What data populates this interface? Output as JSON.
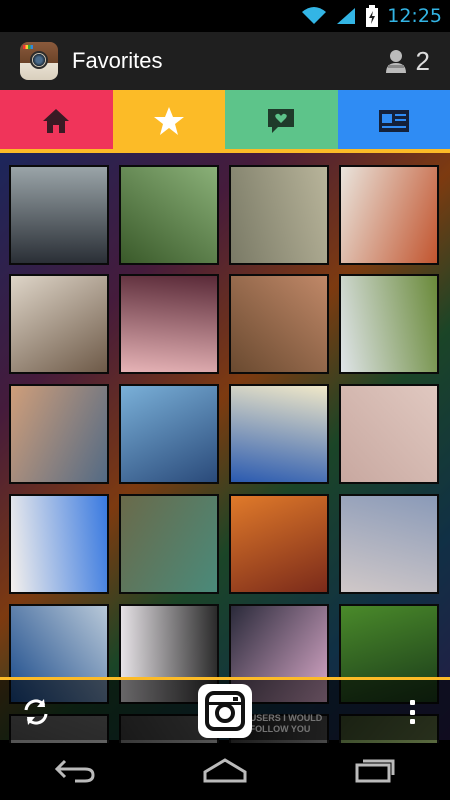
{
  "status_bar": {
    "time": "12:25"
  },
  "action_bar": {
    "title": "Favorites",
    "user_count": "2"
  },
  "tabs": [
    {
      "name": "home",
      "icon": "home-icon",
      "color": "#f0345a"
    },
    {
      "name": "favorites",
      "icon": "star-icon",
      "color": "#fcbb27"
    },
    {
      "name": "news",
      "icon": "heart-speech-icon",
      "color": "#5dc48a"
    },
    {
      "name": "feed",
      "icon": "newspaper-icon",
      "color": "#2f8cf4"
    }
  ],
  "grid": {
    "photos": [
      {
        "desc": "dog on beach",
        "colors": [
          "#2a2f36",
          "#9aa4a8"
        ]
      },
      {
        "desc": "hammock palms",
        "colors": [
          "#3a5a2a",
          "#8ab078"
        ]
      },
      {
        "desc": "foggy field",
        "colors": [
          "#7a7a66",
          "#b8b49a"
        ]
      },
      {
        "desc": "strawberry waffles",
        "colors": [
          "#e9e4dc",
          "#c2552f"
        ]
      },
      {
        "desc": "braided hair",
        "colors": [
          "#ded5c8",
          "#6e5a48"
        ]
      },
      {
        "desc": "woman with red hair",
        "colors": [
          "#e6b3b6",
          "#5a2a38"
        ]
      },
      {
        "desc": "woman portrait",
        "colors": [
          "#6a4a30",
          "#c08868"
        ]
      },
      {
        "desc": "tree in field",
        "colors": [
          "#dfe4e8",
          "#6a8a3a"
        ]
      },
      {
        "desc": "beach sunset",
        "colors": [
          "#cf9e7a",
          "#536a84"
        ]
      },
      {
        "desc": "boats harbor",
        "colors": [
          "#7ab0d8",
          "#2a4a7a"
        ]
      },
      {
        "desc": "fisheye tree sky",
        "colors": [
          "#2a5ab0",
          "#f0e8c8"
        ]
      },
      {
        "desc": "two women robes",
        "colors": [
          "#c8a8a0",
          "#e0c8c0"
        ]
      },
      {
        "desc": "colorful sketch",
        "colors": [
          "#f4f0ec",
          "#3a7ae0"
        ]
      },
      {
        "desc": "bottles wall",
        "colors": [
          "#6a6a4a",
          "#4a8a7a"
        ]
      },
      {
        "desc": "skyscraper orange",
        "colors": [
          "#e07a2a",
          "#7a2a1a"
        ]
      },
      {
        "desc": "denim shorts",
        "colors": [
          "#d0c8c8",
          "#8a9ab8"
        ]
      },
      {
        "desc": "blue sky clouds",
        "colors": [
          "#1a4a8a",
          "#b8c8d8"
        ]
      },
      {
        "desc": "fashion collage",
        "colors": [
          "#e8e4e8",
          "#2a2a2a"
        ]
      },
      {
        "desc": "leg collage",
        "colors": [
          "#2a2a3a",
          "#d8a8c8"
        ]
      },
      {
        "desc": "cheerleaders grass",
        "colors": [
          "#4a8a2a",
          "#1a3a1a"
        ]
      },
      {
        "desc": "partial",
        "colors": [
          "#3a3a3a",
          "#6a6a6a"
        ]
      },
      {
        "desc": "partial",
        "colors": [
          "#2a2a2a",
          "#5a5a5a"
        ]
      },
      {
        "desc": "partial text",
        "colors": [
          "#1a1a1a",
          "#4a4a4a"
        ]
      },
      {
        "desc": "partial",
        "colors": [
          "#3a4a2a",
          "#6a7a4a"
        ]
      }
    ],
    "overlay_text": "IO USERS I WOULD FOLLOW YOU"
  },
  "toolbar": {
    "refresh_icon": "refresh-icon",
    "camera_icon": "camera-icon",
    "overflow_icon": "overflow-menu-icon"
  },
  "nav_bar": {
    "back": "back-icon",
    "home": "home-nav-icon",
    "recents": "recents-icon"
  },
  "colors": {
    "accent_blue": "#33b5e5",
    "underline": "#fcbb27"
  }
}
